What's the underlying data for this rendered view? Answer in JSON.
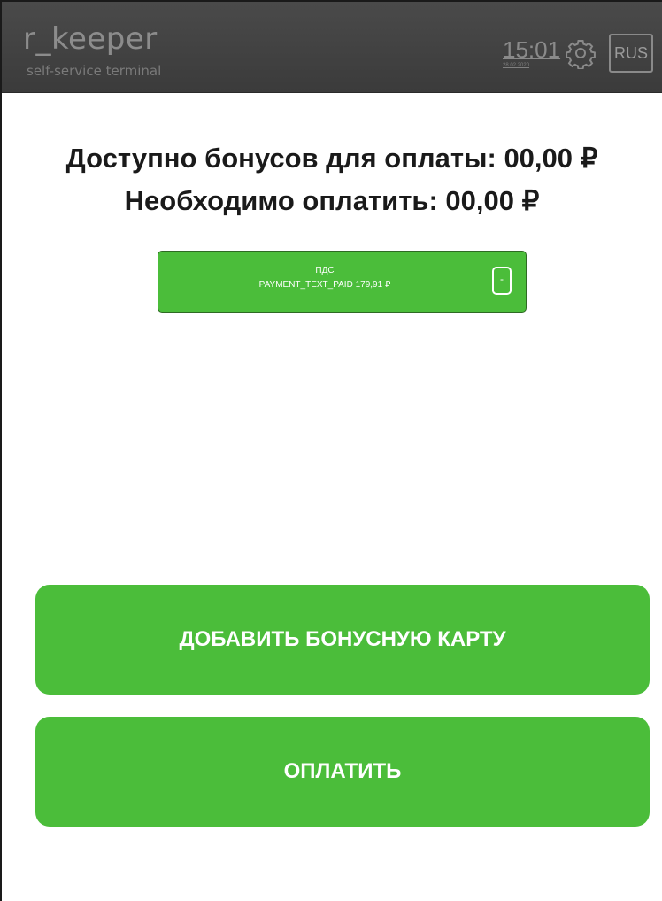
{
  "header": {
    "brand": "r_keeper",
    "brand_sub": "self-service terminal",
    "time": "15:01",
    "date": "28.02.2020",
    "settings_icon": "gear-icon",
    "language": "RUS"
  },
  "summary": {
    "available_bonuses": "Доступно бонусов для оплаты: 00,00 ₽",
    "amount_due": "Необходимо оплатить: 00,00 ₽"
  },
  "payment": {
    "method": "ПДС",
    "paid_line": "PAYMENT_TEXT_PAID 179,91 ₽",
    "remove_label": "-"
  },
  "actions": {
    "add_card": "ДОБАВИТЬ БОНУСНУЮ КАРТУ",
    "pay": "ОПЛАТИТЬ"
  },
  "colors": {
    "accent_green": "#4bbd3a",
    "header_bg": "#3f3f3f",
    "text_dark": "#1a1a1a"
  }
}
